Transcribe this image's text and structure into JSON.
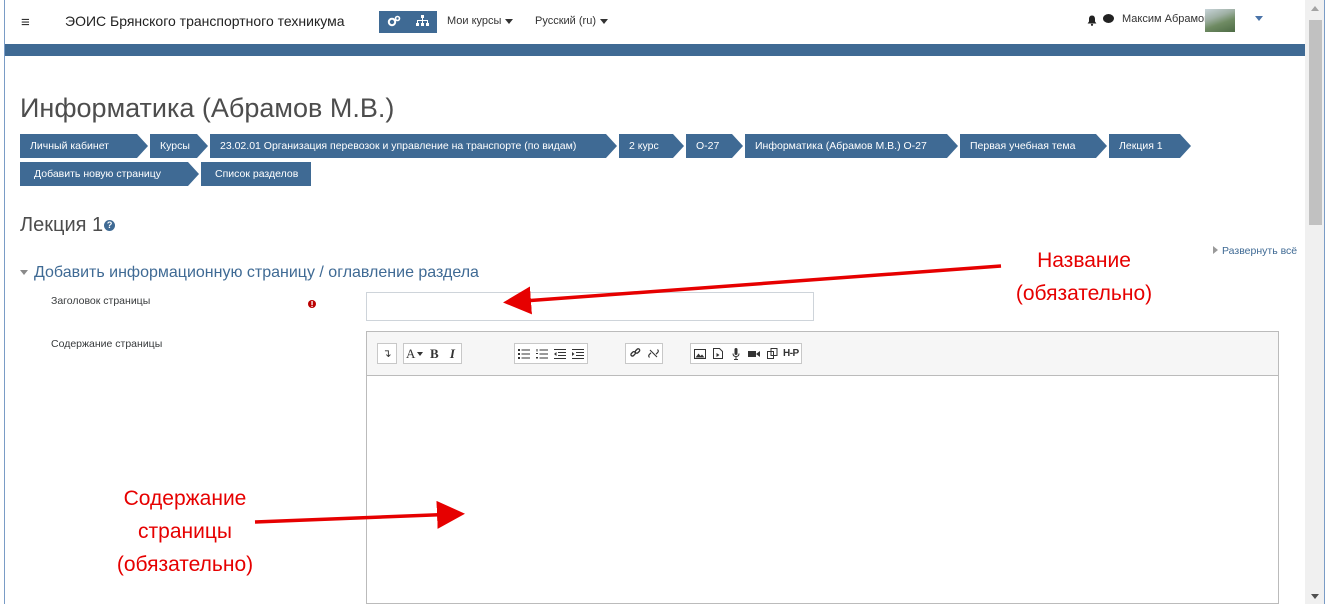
{
  "navbar": {
    "site_name": "ЭОИС Брянского транспортного техникума",
    "my_courses": "Мои курсы",
    "language": "Русский (ru)",
    "user_name": "Максим Абрамов"
  },
  "course_title": "Информатика (Абрамов М.В.)",
  "breadcrumbs": [
    "Личный кабинет",
    "Курсы",
    "23.02.01 Организация перевозок и управление на транспорте (по видам)",
    "2 курс",
    "О-27",
    "Информатика (Абрамов М.В.) О-27",
    "Первая учебная тема",
    "Лекция 1",
    "Добавить новую страницу",
    "Список разделов"
  ],
  "page_heading": "Лекция 1",
  "expand_all": "Развернуть всё",
  "section_title": "Добавить информационную страницу / оглавление раздела",
  "form": {
    "title_label": "Заголовок страницы",
    "title_value": "",
    "content_label": "Содержание страницы"
  },
  "toolbar": {
    "toggle": "↴",
    "font": "A",
    "bold": "B",
    "italic": "I",
    "h5p": "H-P"
  },
  "annotations": {
    "title_line1": "Название",
    "title_line2": "(обязательно)",
    "content_line1": "Содержание",
    "content_line2": "страницы",
    "content_line3": "(обязательно)"
  },
  "colors": {
    "brand": "#3f6a94",
    "annotation": "#e60000"
  }
}
